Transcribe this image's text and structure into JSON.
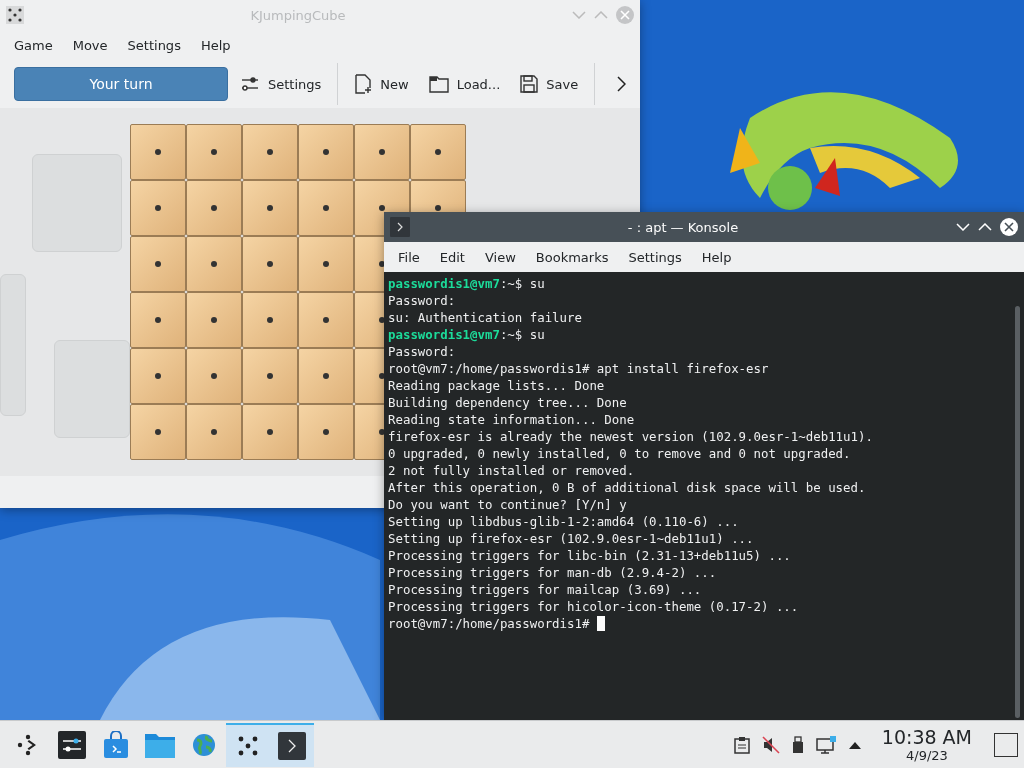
{
  "game_window": {
    "title": "KJumpingCube",
    "menu": [
      "Game",
      "Move",
      "Settings",
      "Help"
    ],
    "toolbar": {
      "status": "Your turn",
      "buttons": [
        {
          "kind": "settings",
          "label": "Settings"
        },
        {
          "kind": "new",
          "label": "New"
        },
        {
          "kind": "load",
          "label": "Load..."
        },
        {
          "kind": "save",
          "label": "Save"
        }
      ]
    }
  },
  "terminal_window": {
    "title": "- : apt — Konsole",
    "menu": [
      "File",
      "Edit",
      "View",
      "Bookmarks",
      "Settings",
      "Help"
    ],
    "lines": [
      {
        "kind": "prompt",
        "user": "passwordis1@vm7",
        "path": ":~$",
        "command": "su"
      },
      {
        "kind": "output",
        "text": "Password:"
      },
      {
        "kind": "output",
        "text": "su: Authentication failure"
      },
      {
        "kind": "prompt",
        "user": "passwordis1@vm7",
        "path": ":~$",
        "command": "su"
      },
      {
        "kind": "output",
        "text": "Password:"
      },
      {
        "kind": "output",
        "text": "root@vm7:/home/passwordis1# apt install firefox-esr"
      },
      {
        "kind": "output",
        "text": "Reading package lists... Done"
      },
      {
        "kind": "output",
        "text": "Building dependency tree... Done"
      },
      {
        "kind": "output",
        "text": "Reading state information... Done"
      },
      {
        "kind": "output",
        "text": "firefox-esr is already the newest version (102.9.0esr-1~deb11u1)."
      },
      {
        "kind": "output",
        "text": "0 upgraded, 0 newly installed, 0 to remove and 0 not upgraded."
      },
      {
        "kind": "output",
        "text": "2 not fully installed or removed."
      },
      {
        "kind": "output",
        "text": "After this operation, 0 B of additional disk space will be used."
      },
      {
        "kind": "output",
        "text": "Do you want to continue? [Y/n] y"
      },
      {
        "kind": "output",
        "text": "Setting up libdbus-glib-1-2:amd64 (0.110-6) ..."
      },
      {
        "kind": "output",
        "text": "Setting up firefox-esr (102.9.0esr-1~deb11u1) ..."
      },
      {
        "kind": "output",
        "text": "Processing triggers for libc-bin (2.31-13+deb11u5) ..."
      },
      {
        "kind": "output",
        "text": "Processing triggers for man-db (2.9.4-2) ..."
      },
      {
        "kind": "output",
        "text": "Processing triggers for mailcap (3.69) ..."
      },
      {
        "kind": "output",
        "text": "Processing triggers for hicolor-icon-theme (0.17-2) ..."
      },
      {
        "kind": "cursor",
        "text": "root@vm7:/home/passwordis1# "
      }
    ]
  },
  "taskbar": {
    "items": [
      {
        "kind": "launcher",
        "selected": false
      },
      {
        "kind": "settings",
        "selected": false
      },
      {
        "kind": "store",
        "selected": false
      },
      {
        "kind": "folder",
        "selected": false
      },
      {
        "kind": "globe",
        "selected": false
      },
      {
        "kind": "dice",
        "selected": true
      },
      {
        "kind": "terminal",
        "selected": true
      }
    ],
    "time": "10:38 AM",
    "date": "4/9/23"
  }
}
